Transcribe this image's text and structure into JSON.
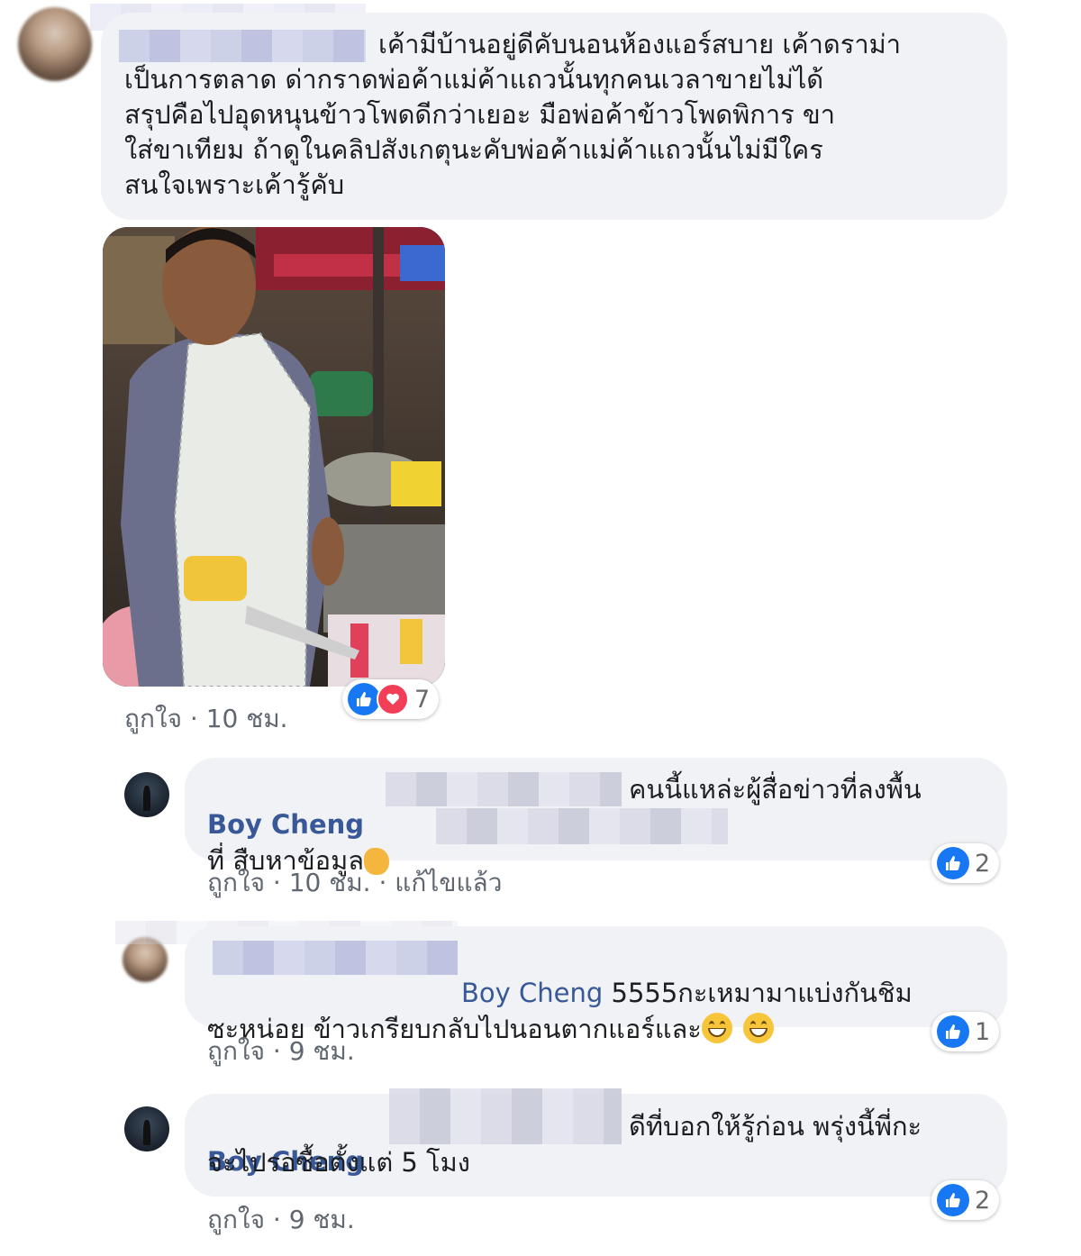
{
  "comments": [
    {
      "text": "เค้ามีบ้านอยู่ดีคับนอนห้องแอร์สบาย เค้าดราม่า\nเป็นการตลาด ด่ากราดพ่อค้าแม่ค้าแถวนั้นทุกคนเวลาขายไม่ได้\nสรุปคือไปอุดหนุนข้าวโพดดีกว่าเยอะ มือพ่อค้าข้าวโพดพิการ ขา\nใส่ขาเทียม ถ้าดูในคลิปสังเกตุนะคับพ่อค้าแม่ค้าแถวนั้นไม่มีใคร\nสนใจเพราะเค้ารู้คับ",
      "like_label": "ถูกใจ",
      "time": "10 ชม.",
      "reaction_count": "7"
    },
    {
      "author": "Boy Cheng",
      "text_line1": "คนนี้แหล่ะผู้สื่อข่าวที่ลงพื้น",
      "text_line2": "ที่ สืบหาข้อมูล",
      "like_label": "ถูกใจ",
      "time": "10 ชม.",
      "edited": "แก้ไขแล้ว",
      "reaction_count": "2"
    },
    {
      "mention": "Boy Cheng",
      "text_line1": " 5555กะเหมามาแบ่งกันชิม",
      "text_line2": "ซะหน่อย ข้าวเกรียบกลับไปนอนตากแอร์และ",
      "like_label": "ถูกใจ",
      "time": "9 ชม.",
      "reaction_count": "1"
    },
    {
      "author": "Boy Cheng",
      "text_line1": "ดีที่บอกให้รู้ก่อน พรุ่งนี้พี่กะ",
      "text_line2": "จะไปรอซื้อตั้งแต่ 5 โมง",
      "like_label": "ถูกใจ",
      "time": "9 ชม.",
      "reaction_count": "2"
    }
  ],
  "separator": " · ",
  "icons": {
    "like": "like-icon",
    "love": "love-icon",
    "emoji": "grinning-face-emoji",
    "hand": "pointing-hand-emoji"
  },
  "colors": {
    "like": "#1877f2",
    "love": "#f33e58",
    "author": "#385898",
    "bubble": "#f0f2f5"
  }
}
